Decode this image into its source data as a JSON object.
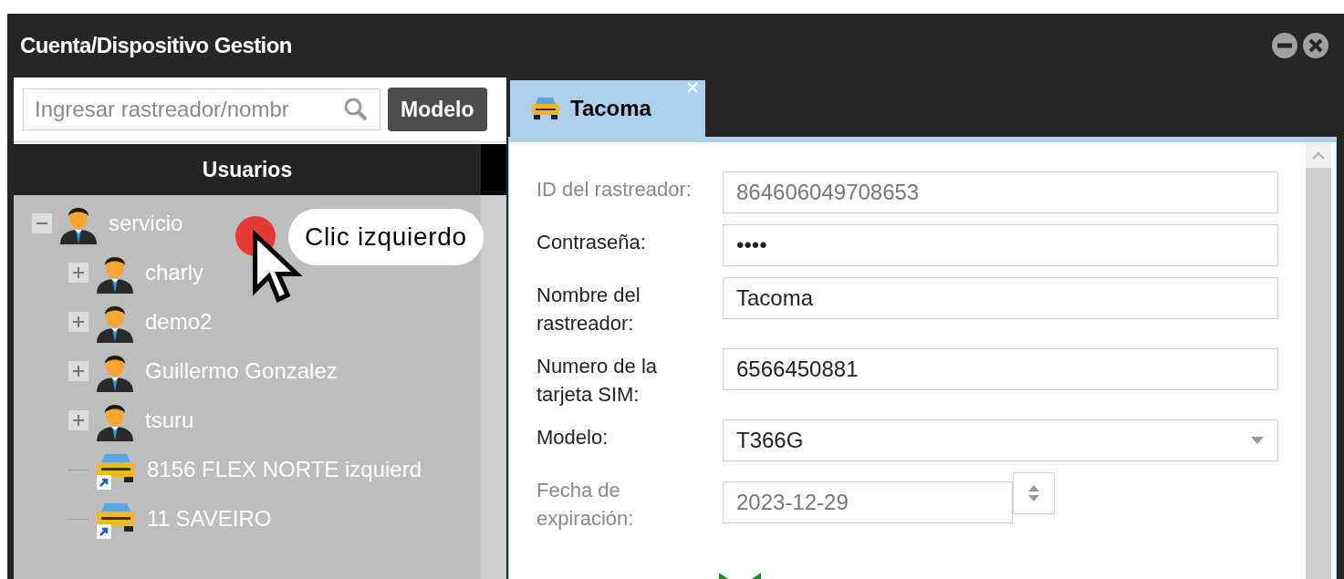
{
  "window": {
    "title": "Cuenta/Dispositivo Gestion"
  },
  "search": {
    "placeholder": "Ingresar rastreador/nombr"
  },
  "model_button": "Modelo",
  "tree": {
    "header": "Usuarios",
    "items": [
      {
        "label": "servicio",
        "kind": "user",
        "expanded": true,
        "children": [
          {
            "label": "charly",
            "kind": "user",
            "expanded": false
          },
          {
            "label": "demo2",
            "kind": "user",
            "expanded": false
          },
          {
            "label": "Guillermo Gonzalez",
            "kind": "user",
            "expanded": false
          },
          {
            "label": "tsuru",
            "kind": "user",
            "expanded": false
          },
          {
            "label": "8156 FLEX NORTE izquierd",
            "kind": "vehicle"
          },
          {
            "label": "11 SAVEIRO",
            "kind": "vehicle"
          }
        ]
      }
    ]
  },
  "annotation": {
    "text": "Clic izquierdo"
  },
  "tabs": [
    {
      "label": "Tacoma",
      "selected": true
    }
  ],
  "form": [
    {
      "label": "ID del rastreador:",
      "value": "864606049708653",
      "kind": "text",
      "disabled": true
    },
    {
      "label": "Contraseña:",
      "value": "••••",
      "kind": "text",
      "disabled": false
    },
    {
      "label": "Nombre del rastreador:",
      "value": "Tacoma",
      "kind": "text",
      "disabled": false
    },
    {
      "label": "Numero de la tarjeta SIM:",
      "value": "6566450881",
      "kind": "text",
      "disabled": false
    },
    {
      "label": "Modelo:",
      "value": "T366G",
      "kind": "select",
      "disabled": false
    },
    {
      "label": "Fecha de expiración:",
      "value": "2023-12-29",
      "kind": "date",
      "disabled": true
    }
  ]
}
